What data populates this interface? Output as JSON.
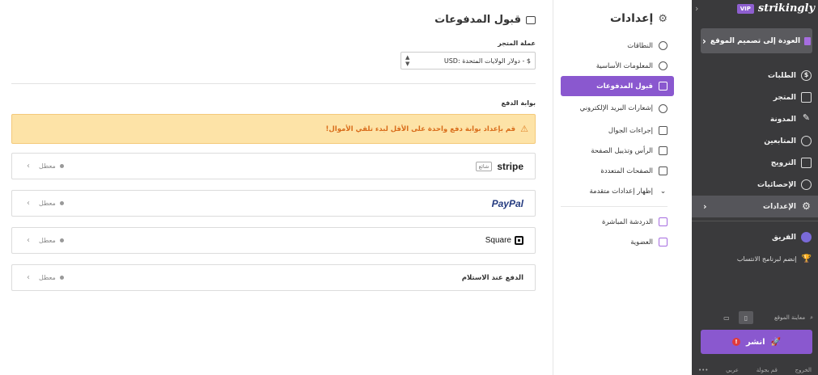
{
  "sidebar": {
    "brand": "strikingly",
    "vip": "VIP",
    "back_label": "العودة إلى تصميم الموقع",
    "items": [
      {
        "label": "الطلبات"
      },
      {
        "label": "المتجر"
      },
      {
        "label": "المدونة"
      },
      {
        "label": "المتابعين"
      },
      {
        "label": "الترويج"
      },
      {
        "label": "الإحصائيات"
      },
      {
        "label": "الإعدادات"
      }
    ],
    "team": "الفريق",
    "affiliate": "إنضم لبرنامج الانتساب",
    "preview_label": "معاينة الموقع",
    "publish_label": "انشر",
    "footer": {
      "logout": "الخروج",
      "tour": "قم بجولة",
      "lang": "عربي",
      "more": "•••"
    }
  },
  "settings": {
    "title": "إعدادات",
    "menu": [
      {
        "label": "النطاقات"
      },
      {
        "label": "المعلومات الأساسية"
      },
      {
        "label": "قبول المدفوعات"
      },
      {
        "label": "إشعارات البريد الإلكتروني"
      },
      {
        "label": "إجراءات الجوال"
      },
      {
        "label": "الرأس وتذييل الصفحة"
      },
      {
        "label": "الصفحات المتعددة"
      },
      {
        "label": "إظهار إعدادات متقدمة"
      }
    ],
    "extra": [
      {
        "label": "الدردشة المباشرة"
      },
      {
        "label": "العضوية"
      }
    ]
  },
  "main": {
    "title": "قبول المدفوعات",
    "currency_label": "عملة المتجر",
    "currency_value": "USD: دولار الولايات المتحدة - $",
    "gateway_label": "بوابة الدفع",
    "warning": "قم بإعداد بوابة دفع واحدة على الأقل لبدء تلقي الأموال!",
    "gateways": [
      {
        "name": "stripe",
        "tag": "شائع",
        "status": "معطل"
      },
      {
        "name": "PayPal",
        "status": "معطل"
      },
      {
        "name": "Square",
        "status": "معطل"
      },
      {
        "name": "الدفع عند الاستلام",
        "status": "معطل"
      }
    ]
  },
  "colors": {
    "accent": "#8a58cf",
    "sidebar_bg": "#3a3a3c",
    "warning_bg": "#fde3a7",
    "warning_text": "#d96c1a"
  }
}
